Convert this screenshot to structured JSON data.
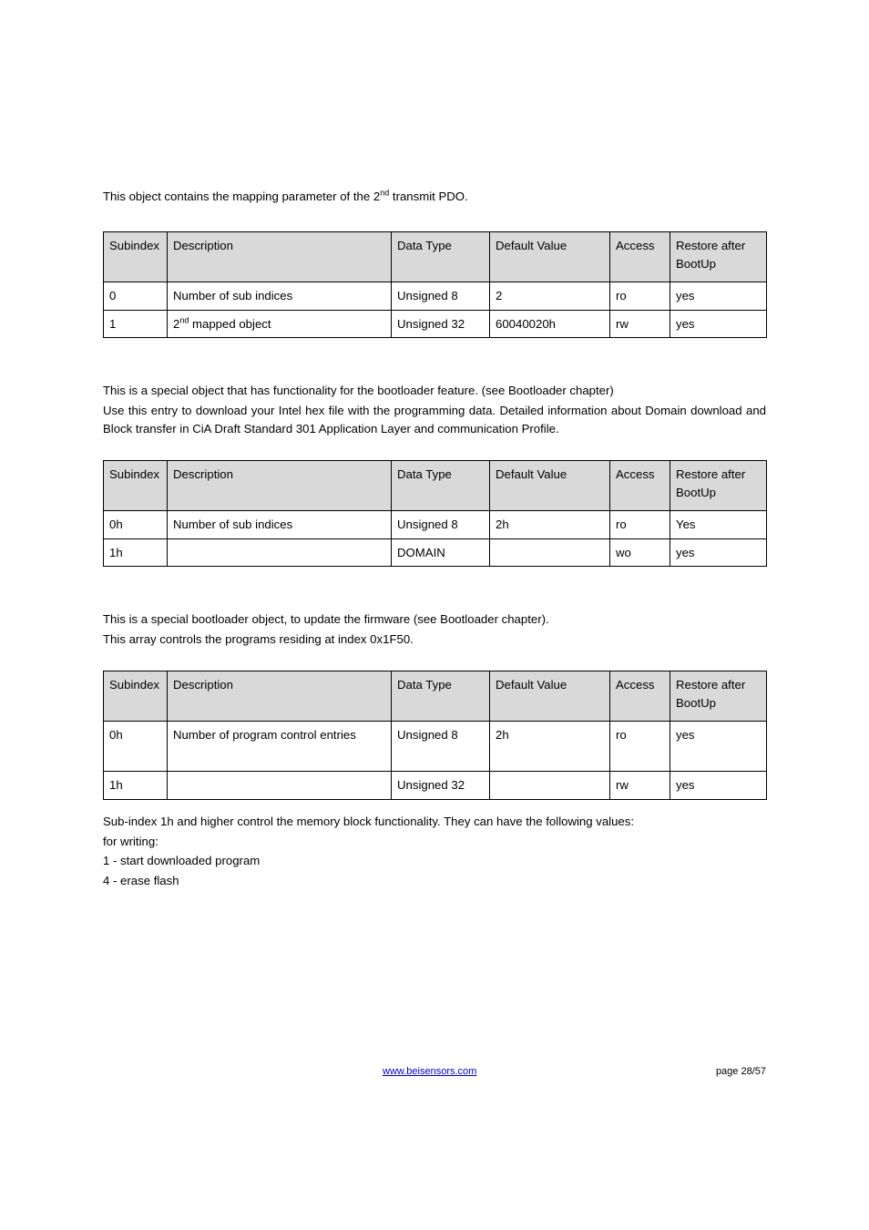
{
  "intro1_a": "This object contains the mapping parameter of the 2",
  "intro1_sup": "nd",
  "intro1_b": " transmit PDO.",
  "headers": {
    "subindex": "Subindex",
    "description": "Description",
    "datatype": "Data Type",
    "default": "Default Value",
    "access": "Access",
    "restore": "Restore after BootUp"
  },
  "t1": {
    "r0": {
      "sub": "0",
      "desc": "Number of sub indices",
      "dtype": "Unsigned 8",
      "def": "2",
      "acc": "ro",
      "rest": "yes"
    },
    "r1": {
      "sub": "1",
      "desc_a": "2",
      "desc_sup": "nd",
      "desc_b": " mapped object",
      "dtype": "Unsigned 32",
      "def": "60040020h",
      "acc": "rw",
      "rest": "yes"
    }
  },
  "para2_l1": "This is a special object that has functionality for the bootloader feature. (see Bootloader chapter)",
  "para2_l2": "Use this entry to download your Intel hex file with the programming data. Detailed information about Domain download and Block transfer in CiA Draft Standard 301 Application Layer and communication Profile.",
  "t2": {
    "r0": {
      "sub": "0h",
      "desc": "Number of sub indices",
      "dtype": "Unsigned 8",
      "def": "2h",
      "acc": "ro",
      "rest": "Yes"
    },
    "r1": {
      "sub": "1h",
      "desc": "",
      "dtype": "DOMAIN",
      "def": "",
      "acc": "wo",
      "rest": "yes"
    }
  },
  "para3_l1": "This is a special bootloader object, to update the firmware (see Bootloader chapter).",
  "para3_l2": "This array controls the programs residing at index 0x1F50.",
  "t3": {
    "r0": {
      "sub": "0h",
      "desc": "Number of program control entries",
      "dtype": "Unsigned 8",
      "def": "2h",
      "acc": "ro",
      "rest": "yes"
    },
    "r1": {
      "sub": "1h",
      "desc": "",
      "dtype": "Unsigned 32",
      "def": "",
      "acc": "rw",
      "rest": "yes"
    }
  },
  "post": {
    "l1": "Sub-index 1h and higher control the memory block functionality. They can have the following values:",
    "l2": "for writing:",
    "l3": "1 - start downloaded program",
    "l4": "4 - erase flash"
  },
  "footer": {
    "url": "www.beisensors.com",
    "page": "page 28/57"
  }
}
